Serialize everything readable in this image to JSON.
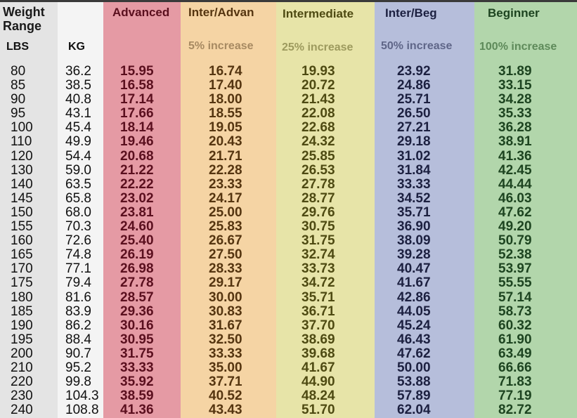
{
  "headers": {
    "weight_range": [
      "Weight",
      "Range"
    ],
    "lbs": "LBS",
    "kg": "KG",
    "advanced": "Advanced",
    "inter_advan": "Inter/Advan",
    "inter_advan_sub": "5% increase",
    "intermediate": "Intermediate",
    "intermediate_sub": "25% increase",
    "inter_beg": "Inter/Beg",
    "inter_beg_sub": "50% increase",
    "beginner": "Beginner",
    "beginner_sub": "100% increase"
  },
  "colors": {
    "lbs_bg": "#e4e4e4",
    "kg_bg": "#f4f4f4",
    "advanced_bg": "#e59aa4",
    "advanced_text": "#5a0f1e",
    "inter_advan_bg": "#f5d4a4",
    "inter_advan_text": "#553510",
    "intermediate_bg": "#e7e4a8",
    "intermediate_text": "#4e4a12",
    "inter_beg_bg": "#b6bedb",
    "inter_beg_text": "#1c2040",
    "beginner_bg": "#b2d6ab",
    "beginner_text": "#1d4420"
  },
  "rows": [
    {
      "lbs": "80",
      "kg": "36.2",
      "advanced": "15.95",
      "inter_advan": "16.74",
      "intermediate": "19.93",
      "inter_beg": "23.92",
      "beginner": "31.89"
    },
    {
      "lbs": "85",
      "kg": "38.5",
      "advanced": "16.58",
      "inter_advan": "17.40",
      "intermediate": "20.72",
      "inter_beg": "24.86",
      "beginner": "33.15"
    },
    {
      "lbs": "90",
      "kg": "40.8",
      "advanced": "17.14",
      "inter_advan": "18.00",
      "intermediate": "21.43",
      "inter_beg": "25.71",
      "beginner": "34.28"
    },
    {
      "lbs": "95",
      "kg": "43.1",
      "advanced": "17.66",
      "inter_advan": "18.55",
      "intermediate": "22.08",
      "inter_beg": "26.50",
      "beginner": "35.33"
    },
    {
      "lbs": "100",
      "kg": "45.4",
      "advanced": "18.14",
      "inter_advan": "19.05",
      "intermediate": "22.68",
      "inter_beg": "27.21",
      "beginner": "36.28"
    },
    {
      "lbs": "110",
      "kg": "49.9",
      "advanced": "19.46",
      "inter_advan": "20.43",
      "intermediate": "24.32",
      "inter_beg": "29.18",
      "beginner": "38.91"
    },
    {
      "lbs": "120",
      "kg": "54.4",
      "advanced": "20.68",
      "inter_advan": "21.71",
      "intermediate": "25.85",
      "inter_beg": "31.02",
      "beginner": "41.36"
    },
    {
      "lbs": "130",
      "kg": "59.0",
      "advanced": "21.22",
      "inter_advan": "22.28",
      "intermediate": "26.53",
      "inter_beg": "31.84",
      "beginner": "42.45"
    },
    {
      "lbs": "140",
      "kg": "63.5",
      "advanced": "22.22",
      "inter_advan": "23.33",
      "intermediate": "27.78",
      "inter_beg": "33.33",
      "beginner": "44.44"
    },
    {
      "lbs": "145",
      "kg": "65.8",
      "advanced": "23.02",
      "inter_advan": "24.17",
      "intermediate": "28.77",
      "inter_beg": "34.52",
      "beginner": "46.03"
    },
    {
      "lbs": "150",
      "kg": "68.0",
      "advanced": "23.81",
      "inter_advan": "25.00",
      "intermediate": "29.76",
      "inter_beg": "35.71",
      "beginner": "47.62"
    },
    {
      "lbs": "155",
      "kg": "70.3",
      "advanced": "24.60",
      "inter_advan": "25.83",
      "intermediate": "30.75",
      "inter_beg": "36.90",
      "beginner": "49.20"
    },
    {
      "lbs": "160",
      "kg": "72.6",
      "advanced": "25.40",
      "inter_advan": "26.67",
      "intermediate": "31.75",
      "inter_beg": "38.09",
      "beginner": "50.79"
    },
    {
      "lbs": "165",
      "kg": "74.8",
      "advanced": "26.19",
      "inter_advan": "27.50",
      "intermediate": "32.74",
      "inter_beg": "39.28",
      "beginner": "52.38"
    },
    {
      "lbs": "170",
      "kg": "77.1",
      "advanced": "26.98",
      "inter_advan": "28.33",
      "intermediate": "33.73",
      "inter_beg": "40.47",
      "beginner": "53.97"
    },
    {
      "lbs": "175",
      "kg": "79.4",
      "advanced": "27.78",
      "inter_advan": "29.17",
      "intermediate": "34.72",
      "inter_beg": "41.67",
      "beginner": "55.55"
    },
    {
      "lbs": "180",
      "kg": "81.6",
      "advanced": "28.57",
      "inter_advan": "30.00",
      "intermediate": "35.71",
      "inter_beg": "42.86",
      "beginner": "57.14"
    },
    {
      "lbs": "185",
      "kg": "83.9",
      "advanced": "29.36",
      "inter_advan": "30.83",
      "intermediate": "36.71",
      "inter_beg": "44.05",
      "beginner": "58.73"
    },
    {
      "lbs": "190",
      "kg": "86.2",
      "advanced": "30.16",
      "inter_advan": "31.67",
      "intermediate": "37.70",
      "inter_beg": "45.24",
      "beginner": "60.32"
    },
    {
      "lbs": "195",
      "kg": "88.4",
      "advanced": "30.95",
      "inter_advan": "32.50",
      "intermediate": "38.69",
      "inter_beg": "46.43",
      "beginner": "61.90"
    },
    {
      "lbs": "200",
      "kg": "90.7",
      "advanced": "31.75",
      "inter_advan": "33.33",
      "intermediate": "39.68",
      "inter_beg": "47.62",
      "beginner": "63.49"
    },
    {
      "lbs": "210",
      "kg": "95.2",
      "advanced": "33.33",
      "inter_advan": "35.00",
      "intermediate": "41.67",
      "inter_beg": "50.00",
      "beginner": "66.66"
    },
    {
      "lbs": "220",
      "kg": "99.8",
      "advanced": "35.92",
      "inter_advan": "37.71",
      "intermediate": "44.90",
      "inter_beg": "53.88",
      "beginner": "71.83"
    },
    {
      "lbs": "230",
      "kg": "104.3",
      "advanced": "38.59",
      "inter_advan": "40.52",
      "intermediate": "48.24",
      "inter_beg": "57.89",
      "beginner": "77.19"
    },
    {
      "lbs": "240",
      "kg": "108.8",
      "advanced": "41.36",
      "inter_advan": "43.43",
      "intermediate": "51.70",
      "inter_beg": "62.04",
      "beginner": "82.72"
    }
  ]
}
